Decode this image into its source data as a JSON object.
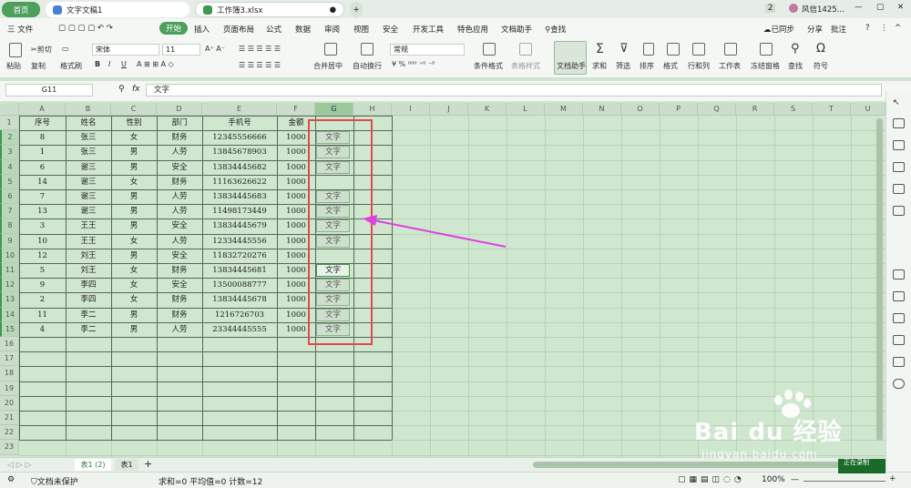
{
  "window": {
    "home_tab": "首页",
    "doc_tab": "文字文稿1",
    "sheet_tab": "工作簿3.xlsx",
    "badge": "2",
    "user": "风信1425...",
    "min": "—",
    "max": "□",
    "close": "✕"
  },
  "menu": {
    "file": "三 文件",
    "items": [
      "开始",
      "插入",
      "页面布局",
      "公式",
      "数据",
      "审阅",
      "视图",
      "安全",
      "开发工具",
      "特色应用",
      "文档助手"
    ],
    "search": "查找",
    "sync": "已同步",
    "share": "分享",
    "comment": "批注"
  },
  "ribbon": {
    "paste": "粘贴",
    "cut": "剪切",
    "copy": "复制",
    "format_painter": "格式刷",
    "font": "宋体",
    "font_size": "11",
    "merge": "合并居中",
    "wrap": "自动换行",
    "num_format": "常规",
    "cond_format": "条件格式",
    "table_style": "表格样式",
    "doc_helper": "文档助手",
    "sum": "求和",
    "filter": "筛选",
    "sort": "排序",
    "format": "格式",
    "rowcol": "行和列",
    "worksheet": "工作表",
    "freeze": "冻结窗格",
    "find": "查找",
    "symbol": "符号",
    "bold": "B",
    "italic": "I",
    "underline": "U"
  },
  "formula_bar": {
    "cell_ref": "G11",
    "fx": "fx",
    "value": "文字"
  },
  "columns": [
    "A",
    "B",
    "C",
    "D",
    "E",
    "F",
    "G",
    "H",
    "I",
    "J",
    "K",
    "L",
    "M",
    "N",
    "O",
    "P",
    "Q",
    "R",
    "S",
    "T",
    "U"
  ],
  "table": {
    "headers": [
      "序号",
      "姓名",
      "性别",
      "部门",
      "手机号",
      "金额"
    ],
    "rows": [
      [
        "8",
        "张三",
        "女",
        "财务",
        "12345556666",
        "1000",
        "文字"
      ],
      [
        "1",
        "张三",
        "男",
        "人劳",
        "13845678903",
        "1000",
        "文字"
      ],
      [
        "6",
        "谢三",
        "男",
        "安全",
        "13834445682",
        "1000",
        "文字"
      ],
      [
        "14",
        "谢三",
        "女",
        "财务",
        "11163626622",
        "1000",
        ""
      ],
      [
        "7",
        "谢三",
        "男",
        "人劳",
        "13834445683",
        "1000",
        "文字"
      ],
      [
        "13",
        "谢三",
        "男",
        "人劳",
        "11498173449",
        "1000",
        "文字"
      ],
      [
        "3",
        "王王",
        "男",
        "安全",
        "13834445679",
        "1000",
        "文字"
      ],
      [
        "10",
        "王王",
        "女",
        "人劳",
        "12334445556",
        "1000",
        "文字"
      ],
      [
        "12",
        "刘王",
        "男",
        "安全",
        "11832720276",
        "1000",
        ""
      ],
      [
        "5",
        "刘王",
        "女",
        "财务",
        "13834445681",
        "1000",
        "文字"
      ],
      [
        "9",
        "李四",
        "女",
        "安全",
        "13500088777",
        "1000",
        "文字"
      ],
      [
        "2",
        "李四",
        "女",
        "财务",
        "13834445678",
        "1000",
        "文字"
      ],
      [
        "11",
        "李二",
        "男",
        "财务",
        "1216726703",
        "1000",
        "文字"
      ],
      [
        "4",
        "李二",
        "男",
        "人劳",
        "23344445555",
        "1000",
        "文字"
      ]
    ]
  },
  "row_numbers": [
    "1",
    "2",
    "3",
    "4",
    "5",
    "6",
    "7",
    "8",
    "9",
    "10",
    "11",
    "12",
    "13",
    "14",
    "15",
    "16",
    "17",
    "18",
    "19",
    "20",
    "21",
    "22",
    "23"
  ],
  "sheets": [
    "表1 (2)",
    "表1",
    "+"
  ],
  "status": {
    "protect": "文档未保护",
    "stats": "求和=0  平均值=0  计数=12",
    "zoom": "100%",
    "minus": "—",
    "plus": "+"
  },
  "watermark": {
    "brand": "Bai du 经验",
    "url": "jingyan.baidu.com",
    "tag": "正在录制"
  },
  "colors": {
    "accent": "#4d9f5b",
    "highlight_box": "#e04a4a",
    "arrow": "#e040e0"
  }
}
